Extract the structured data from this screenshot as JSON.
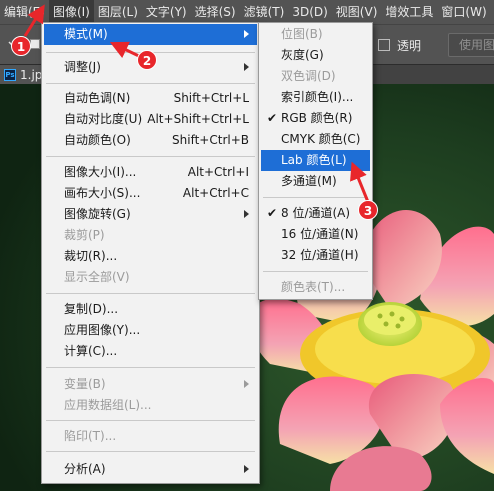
{
  "menubar": {
    "items": [
      "编辑(E)",
      "图像(I)",
      "图层(L)",
      "文字(Y)",
      "选择(S)",
      "滤镜(T)",
      "3D(D)",
      "视图(V)",
      "增效工具",
      "窗口(W)"
    ]
  },
  "options": {
    "checkbox_label": "透明",
    "button_label": "使用图"
  },
  "document": {
    "tab_name": "1.jp",
    "ps_icon": "Ps"
  },
  "image_menu": {
    "items": [
      {
        "label": "模式(M)",
        "shortcut": "",
        "submenu": true,
        "disabled": false,
        "highlighted": true
      },
      {
        "label": "调整(J)",
        "shortcut": "",
        "submenu": true,
        "disabled": false
      },
      {
        "label": "自动色调(N)",
        "shortcut": "Shift+Ctrl+L",
        "disabled": false
      },
      {
        "label": "自动对比度(U)",
        "shortcut": "Alt+Shift+Ctrl+L",
        "disabled": false
      },
      {
        "label": "自动颜色(O)",
        "shortcut": "Shift+Ctrl+B",
        "disabled": false
      },
      {
        "label": "图像大小(I)...",
        "shortcut": "Alt+Ctrl+I",
        "disabled": false
      },
      {
        "label": "画布大小(S)...",
        "shortcut": "Alt+Ctrl+C",
        "disabled": false
      },
      {
        "label": "图像旋转(G)",
        "shortcut": "",
        "submenu": true,
        "disabled": false
      },
      {
        "label": "裁剪(P)",
        "shortcut": "",
        "disabled": true
      },
      {
        "label": "裁切(R)...",
        "shortcut": "",
        "disabled": false
      },
      {
        "label": "显示全部(V)",
        "shortcut": "",
        "disabled": true
      },
      {
        "label": "复制(D)...",
        "shortcut": "",
        "disabled": false
      },
      {
        "label": "应用图像(Y)...",
        "shortcut": "",
        "disabled": false
      },
      {
        "label": "计算(C)...",
        "shortcut": "",
        "disabled": false
      },
      {
        "label": "变量(B)",
        "shortcut": "",
        "submenu": true,
        "disabled": true
      },
      {
        "label": "应用数据组(L)...",
        "shortcut": "",
        "disabled": true
      },
      {
        "label": "陷印(T)...",
        "shortcut": "",
        "disabled": true
      },
      {
        "label": "分析(A)",
        "shortcut": "",
        "submenu": true,
        "disabled": false
      }
    ]
  },
  "mode_submenu": {
    "items": [
      {
        "label": "位图(B)",
        "disabled": true
      },
      {
        "label": "灰度(G)",
        "disabled": false
      },
      {
        "label": "双色调(D)",
        "disabled": true
      },
      {
        "label": "索引颜色(I)...",
        "disabled": false
      },
      {
        "label": "RGB 颜色(R)",
        "disabled": false,
        "checked": true
      },
      {
        "label": "CMYK 颜色(C)",
        "disabled": false
      },
      {
        "label": "Lab 颜色(L)",
        "disabled": false,
        "highlighted": true
      },
      {
        "label": "多通道(M)",
        "disabled": false
      },
      {
        "label": "8 位/通道(A)",
        "disabled": false,
        "checked": true
      },
      {
        "label": "16 位/通道(N)",
        "disabled": false
      },
      {
        "label": "32 位/通道(H)",
        "disabled": false
      },
      {
        "label": "颜色表(T)...",
        "disabled": true
      }
    ]
  },
  "annotations": {
    "badges": [
      "1",
      "2",
      "3"
    ],
    "color": "#e8262b"
  },
  "colors": {
    "highlight": "#1e6ed6",
    "menu_bg": "#f2f2f2",
    "app_bg": "#535353"
  }
}
